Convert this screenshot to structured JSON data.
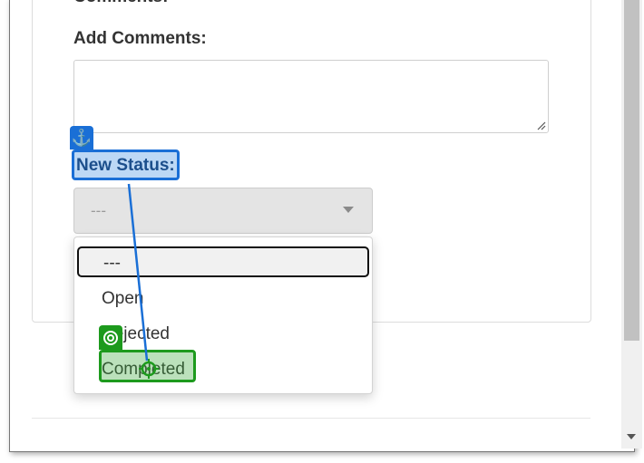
{
  "form": {
    "comments_label": "Comments:",
    "add_comments_label": "Add Comments:",
    "add_comments_value": "",
    "new_status_label": "New Status:",
    "status_select_value": "---"
  },
  "dropdown": {
    "options": [
      "---",
      "Open",
      "Rejected",
      "Completed"
    ],
    "selected_index": 0
  },
  "overlay": {
    "anchor_icon": "anchor-icon",
    "target_icon": "target-icon",
    "anchor_color": "#1a6fd6",
    "target_color": "#1d9a1d"
  }
}
